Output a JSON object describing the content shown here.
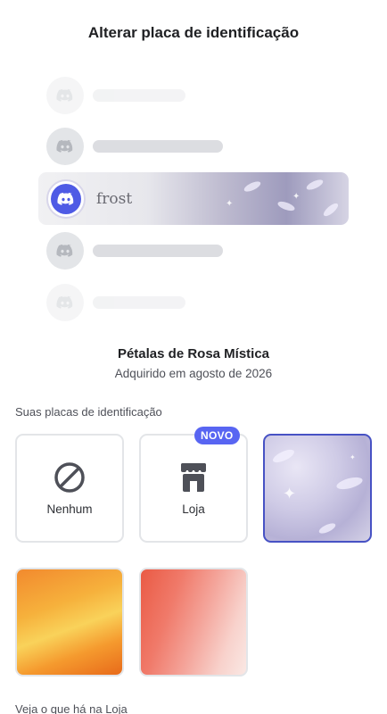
{
  "header": {
    "title": "Alterar placa de identificação"
  },
  "preview": {
    "selected_user": {
      "name": "frost"
    }
  },
  "plate": {
    "name": "Pétalas de Rosa Mística",
    "acquired": "Adquirido em agosto de 2026"
  },
  "your_plates": {
    "label": "Suas placas de identificação",
    "items": [
      {
        "label": "Nenhum",
        "icon": "prohibited-icon"
      },
      {
        "label": "Loja",
        "icon": "store-icon",
        "badge": "NOVO"
      },
      {
        "label": "",
        "icon": "",
        "selected": true,
        "name": "Pétalas de Rosa Mística"
      }
    ],
    "extra": [
      "orange-plate",
      "red-plate"
    ]
  },
  "shop_section": {
    "label": "Veja o que há na Loja"
  },
  "colors": {
    "accent": "#5865f2",
    "selected_border": "#4752c4"
  }
}
